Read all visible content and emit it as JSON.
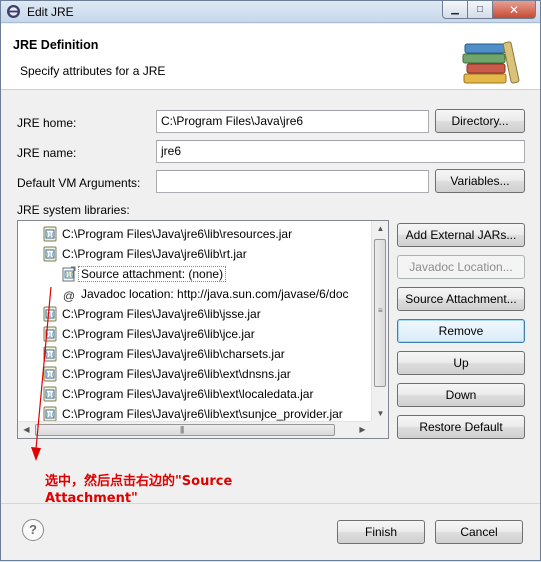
{
  "window": {
    "title": "Edit JRE",
    "controls": {
      "minimize": "▁",
      "maximize": "□",
      "close": "✕"
    }
  },
  "header": {
    "title": "JRE Definition",
    "subtitle": "Specify attributes for a JRE",
    "icon": "library-books-icon"
  },
  "form": {
    "jre_home_label": "JRE home:",
    "jre_home_value": "C:\\Program Files\\Java\\jre6",
    "directory_button": "Directory...",
    "jre_name_label": "JRE name:",
    "jre_name_value": "jre6",
    "vm_args_label": "Default VM Arguments:",
    "vm_args_value": "",
    "variables_button": "Variables...",
    "libraries_label": "JRE system libraries:"
  },
  "libraries": [
    {
      "label": "C:\\Program Files\\Java\\jre6\\lib\\resources.jar",
      "icon": "jar-icon",
      "level": 0
    },
    {
      "label": "C:\\Program Files\\Java\\jre6\\lib\\rt.jar",
      "icon": "jar-icon",
      "level": 0
    },
    {
      "label": "Source attachment: (none)",
      "icon": "source-attachment-icon",
      "level": 1,
      "selected": true
    },
    {
      "label": "Javadoc location: http://java.sun.com/javase/6/doc",
      "icon": "javadoc-icon",
      "level": 1
    },
    {
      "label": "C:\\Program Files\\Java\\jre6\\lib\\jsse.jar",
      "icon": "jar-icon",
      "level": 0
    },
    {
      "label": "C:\\Program Files\\Java\\jre6\\lib\\jce.jar",
      "icon": "jar-icon",
      "level": 0
    },
    {
      "label": "C:\\Program Files\\Java\\jre6\\lib\\charsets.jar",
      "icon": "jar-icon",
      "level": 0
    },
    {
      "label": "C:\\Program Files\\Java\\jre6\\lib\\ext\\dnsns.jar",
      "icon": "jar-icon",
      "level": 0
    },
    {
      "label": "C:\\Program Files\\Java\\jre6\\lib\\ext\\localedata.jar",
      "icon": "jar-icon",
      "level": 0
    },
    {
      "label": "C:\\Program Files\\Java\\jre6\\lib\\ext\\sunjce_provider.jar",
      "icon": "jar-icon",
      "level": 0
    }
  ],
  "side_buttons": {
    "add_external_jars": "Add External JARs...",
    "javadoc_location": "Javadoc Location...",
    "source_attachment": "Source Attachment...",
    "remove": "Remove",
    "up": "Up",
    "down": "Down",
    "restore_default": "Restore Default"
  },
  "annotation": {
    "text": "选中，然后点击右边的\"Source Attachment\"",
    "color": "#e00000"
  },
  "footer": {
    "help": "?",
    "finish": "Finish",
    "cancel": "Cancel"
  }
}
